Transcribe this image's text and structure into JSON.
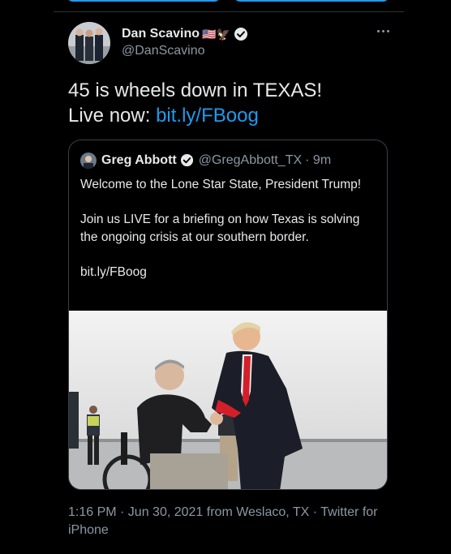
{
  "tweet": {
    "author_name": "Dan Scavino",
    "author_emojis": "🇺🇸🦅",
    "author_handle": "@DanScavino",
    "text_line1": "45 is wheels down in TEXAS!",
    "text_line2_prefix": "Live now: ",
    "text_link": "bit.ly/FBoog",
    "footer": "1:16 PM · Jun 30, 2021 from Weslaco, TX · Twitter for iPhone"
  },
  "quote": {
    "author_name": "Greg Abbott",
    "author_handle": "@GregAbbott_TX",
    "time": "· 9m",
    "para1": "Welcome to the Lone Star State, President Trump!",
    "para2": "Join us LIVE for a briefing on how Texas is solving the ongoing crisis at our southern border.",
    "para3": "bit.ly/FBoog"
  },
  "icons": {
    "verified": "verified-badge-icon",
    "more": "more-dots-icon"
  },
  "colors": {
    "background": "#000000",
    "link": "#1d9bf0",
    "secondary_text": "#8b98a5",
    "border": "#3a3f44"
  }
}
